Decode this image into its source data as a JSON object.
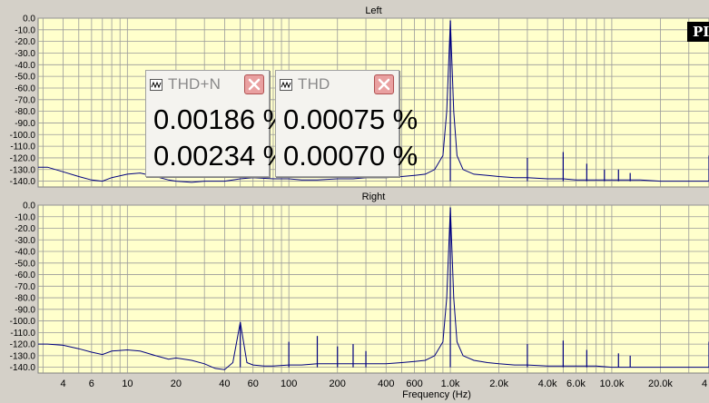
{
  "chart_data": [
    {
      "type": "line",
      "title": "Left",
      "xlabel": "Frequency (Hz)",
      "ylabel": "",
      "x_scale": "log",
      "xlim": [
        2.8,
        40000
      ],
      "ylim": [
        -145,
        0
      ],
      "grid": true,
      "x_ticks": [
        4,
        6,
        10,
        20,
        40,
        60,
        100,
        200,
        400,
        600,
        1000,
        2000,
        4000,
        6000,
        10000,
        20000,
        40000
      ],
      "x_tick_labels": [
        "4",
        "6",
        "10",
        "20",
        "40",
        "60",
        "100",
        "200",
        "400",
        "600",
        "1.0k",
        "2.0k",
        "4.0k",
        "6.0k",
        "10.0k",
        "20.0k",
        "4"
      ],
      "y_ticks": [
        0,
        -10,
        -20,
        -30,
        -40,
        -50,
        -60,
        -70,
        -80,
        -90,
        -100,
        -110,
        -120,
        -130,
        -140
      ],
      "y_tick_labels": [
        "0.0",
        "-10.0",
        "-20.0",
        "-30.0",
        "-40.0",
        "-50.0",
        "-60.0",
        "-70.0",
        "-80.0",
        "-90.0",
        "-100.0",
        "-110.0",
        "-120.0",
        "-130.0",
        "-140.0"
      ],
      "series": [
        {
          "color": "#000080",
          "x": [
            2.8,
            3.2,
            4,
            5,
            6,
            7,
            8,
            10,
            12,
            15,
            18,
            20,
            25,
            30,
            40,
            50,
            60,
            80,
            100,
            120,
            150,
            200,
            250,
            300,
            400,
            500,
            600,
            700,
            800,
            900,
            950,
            1000,
            1050,
            1100,
            1200,
            1400,
            1700,
            2000,
            2500,
            3000,
            4000,
            5000,
            6000,
            8000,
            10000,
            15000,
            20000,
            30000,
            40000
          ],
          "y": [
            -128,
            -128,
            -132,
            -136,
            -139,
            -140,
            -137,
            -134,
            -133,
            -136,
            -139,
            -140,
            -141,
            -140,
            -140,
            -138,
            -137,
            -138,
            -138,
            -139,
            -139,
            -138,
            -138,
            -137,
            -137,
            -136,
            -135,
            -134,
            -130,
            -118,
            -80,
            -2,
            -80,
            -118,
            -130,
            -134,
            -135,
            -136,
            -137,
            -137,
            -138,
            -138,
            -139,
            -139,
            -139,
            -139,
            -140,
            -140,
            -140
          ]
        }
      ],
      "spikes": [
        [
          1000,
          -2
        ],
        [
          3000,
          -120
        ],
        [
          5000,
          -115
        ],
        [
          7000,
          -125
        ],
        [
          9000,
          -130
        ],
        [
          11000,
          -130
        ],
        [
          13000,
          -133
        ],
        [
          40000,
          -118
        ]
      ]
    },
    {
      "type": "line",
      "title": "Right",
      "xlabel": "Frequency (Hz)",
      "ylabel": "",
      "x_scale": "log",
      "xlim": [
        2.8,
        40000
      ],
      "ylim": [
        -145,
        0
      ],
      "grid": true,
      "x_ticks": [
        4,
        6,
        10,
        20,
        40,
        60,
        100,
        200,
        400,
        600,
        1000,
        2000,
        4000,
        6000,
        10000,
        20000,
        40000
      ],
      "x_tick_labels": [
        "4",
        "6",
        "10",
        "20",
        "40",
        "60",
        "100",
        "200",
        "400",
        "600",
        "1.0k",
        "2.0k",
        "4.0k",
        "6.0k",
        "10.0k",
        "20.0k",
        "4"
      ],
      "y_ticks": [
        0,
        -10,
        -20,
        -30,
        -40,
        -50,
        -60,
        -70,
        -80,
        -90,
        -100,
        -110,
        -120,
        -130,
        -140
      ],
      "y_tick_labels": [
        "0.0",
        "-10.0",
        "-20.0",
        "-30.0",
        "-40.0",
        "-50.0",
        "-60.0",
        "-70.0",
        "-80.0",
        "-90.0",
        "-100.0",
        "-110.0",
        "-120.0",
        "-130.0",
        "-140.0"
      ],
      "series": [
        {
          "color": "#000080",
          "x": [
            2.8,
            3.2,
            4,
            5,
            6,
            7,
            8,
            10,
            12,
            15,
            18,
            20,
            25,
            30,
            35,
            40,
            45,
            50,
            55,
            60,
            70,
            80,
            100,
            120,
            150,
            200,
            250,
            300,
            400,
            500,
            600,
            700,
            800,
            900,
            950,
            1000,
            1050,
            1100,
            1200,
            1400,
            1700,
            2000,
            2500,
            3000,
            4000,
            5000,
            6000,
            8000,
            10000,
            15000,
            20000,
            30000,
            40000
          ],
          "y": [
            -120,
            -120,
            -121,
            -124,
            -127,
            -129,
            -126,
            -125,
            -126,
            -130,
            -133,
            -132,
            -134,
            -137,
            -141,
            -142,
            -136,
            -101,
            -136,
            -138,
            -139,
            -139,
            -138,
            -138,
            -137,
            -137,
            -137,
            -137,
            -137,
            -136,
            -135,
            -134,
            -130,
            -118,
            -80,
            -2,
            -80,
            -118,
            -130,
            -134,
            -136,
            -137,
            -138,
            -138,
            -139,
            -139,
            -139,
            -139,
            -140,
            -140,
            -140,
            -140,
            -140
          ]
        }
      ],
      "spikes": [
        [
          1000,
          -2
        ],
        [
          50,
          -101
        ],
        [
          100,
          -118
        ],
        [
          150,
          -113
        ],
        [
          200,
          -122
        ],
        [
          250,
          -120
        ],
        [
          300,
          -126
        ],
        [
          3000,
          -120
        ],
        [
          5000,
          -117
        ],
        [
          7000,
          -125
        ],
        [
          11000,
          -128
        ],
        [
          13000,
          -130
        ],
        [
          40000,
          -118
        ]
      ]
    }
  ],
  "meters": [
    {
      "name": "THD+N",
      "values": [
        "0.00186 %",
        "0.00234 %"
      ]
    },
    {
      "name": "THD",
      "values": [
        "0.00075 %",
        "0.00070 %"
      ]
    }
  ],
  "logo_text": "PI",
  "colors": {
    "plot_bg": "#ffffcc",
    "grid": "#9a9a9a",
    "trace": "#000080",
    "window_bg": "#d4d0c8"
  }
}
